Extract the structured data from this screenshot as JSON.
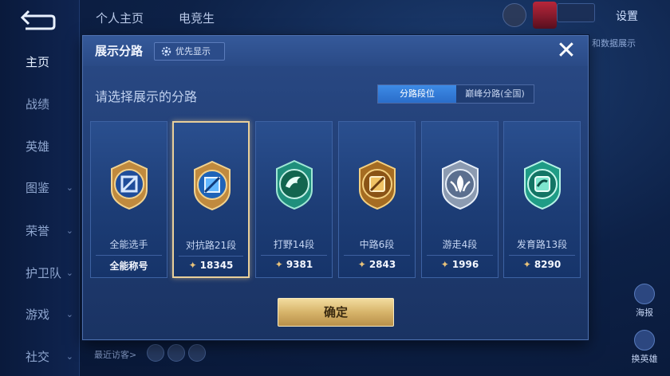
{
  "background": {
    "sidebar": [
      {
        "label": "主页",
        "active": true
      },
      {
        "label": "战绩"
      },
      {
        "label": "英雄"
      },
      {
        "label": "图鉴",
        "chevron": true
      },
      {
        "label": "荣誉",
        "chevron": true
      },
      {
        "label": "护卫队",
        "chevron": true
      },
      {
        "label": "游戏",
        "chevron": true
      },
      {
        "label": "社交",
        "chevron": true
      }
    ],
    "tabs": [
      "个人主页",
      "电竞生"
    ],
    "settings": "设置",
    "right_hint": "和数据展示",
    "recent_visitors": "最近访客>",
    "right_signs": [
      "海报",
      "换英雄"
    ],
    "chevron_glyph": "⌄"
  },
  "modal": {
    "title": "展示分路",
    "priority_button": "优先显示",
    "close_glyph": "✕",
    "prompt": "请选择展示的分路",
    "segments": [
      {
        "label": "分路段位",
        "active": true
      },
      {
        "label": "巅峰分路(全国)",
        "active": false
      }
    ],
    "star_glyph": "✦",
    "cards": [
      {
        "name": "全能选手",
        "value": "全能称号",
        "has_star": false,
        "emblem": "allround-emblem-icon",
        "color": "#5a8fe0"
      },
      {
        "name": "对抗路21段",
        "value": "18345",
        "has_star": true,
        "selected": true,
        "emblem": "clash-lane-emblem-icon",
        "color": "#3f9ff0"
      },
      {
        "name": "打野14段",
        "value": "9381",
        "has_star": true,
        "emblem": "jungle-emblem-icon",
        "color": "#2fb89a"
      },
      {
        "name": "中路6段",
        "value": "2843",
        "has_star": true,
        "emblem": "mid-lane-emblem-icon",
        "color": "#c49034"
      },
      {
        "name": "游走4段",
        "value": "1996",
        "has_star": true,
        "emblem": "roam-emblem-icon",
        "color": "#b9c6d8"
      },
      {
        "name": "发育路13段",
        "value": "8290",
        "has_star": true,
        "emblem": "farm-lane-emblem-icon",
        "color": "#2cc0a8"
      }
    ],
    "confirm": "确定"
  },
  "colors": {
    "accent_blue": "#2a6dc9",
    "gold": "#d7b46a",
    "selected_border": "#e8cf9a"
  }
}
